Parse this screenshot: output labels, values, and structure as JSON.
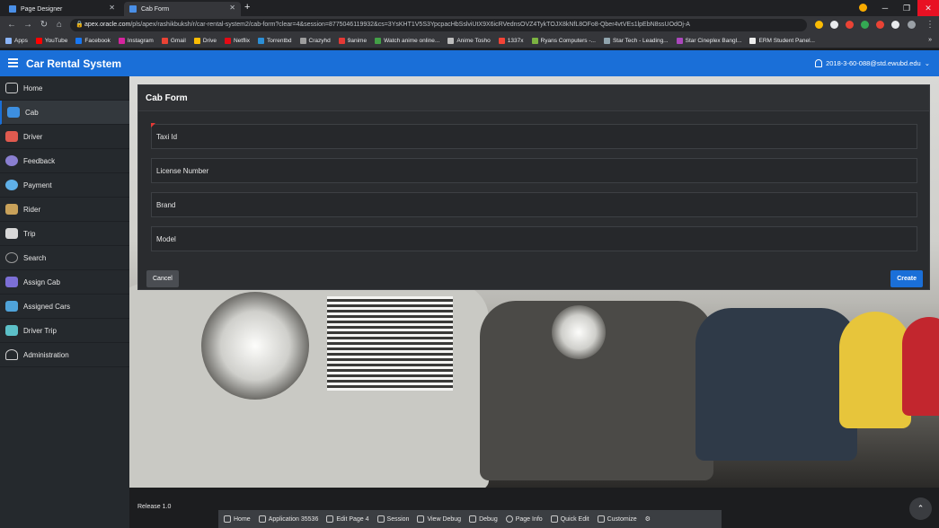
{
  "browser": {
    "tabs": [
      {
        "title": "Page Designer"
      },
      {
        "title": "Cab Form"
      }
    ],
    "new_tab": "+",
    "url_host": "apex.oracle.com",
    "url_path": "/pls/apex/rashikbuksh/r/car-rental-system2/cab-form?clear=4&session=8775046119932&cs=3YsKHT1V5S3YpcpacHbSslviUtX9X6icRVednsOVZ4TykTOJX8kNfL8OFo8-Qber4vtVEs1lpEbN8ssUOdOj-A",
    "bookmarks": [
      "Apps",
      "YouTube",
      "Facebook",
      "Instagram",
      "Gmail",
      "Drive",
      "Netflix",
      "Torrentbd",
      "Crazyhd",
      "9anime",
      "Watch anime online...",
      "Anime Tosho",
      "1337x",
      "Ryans Computers -...",
      "Star Tech - Leading...",
      "Star Cineplex Bangl...",
      "ERM Student Panel..."
    ],
    "bookmarks_more": "»",
    "colors": {
      "frame": "#202124",
      "toolbar": "#35363a"
    }
  },
  "header": {
    "title": "Car Rental System",
    "user": "2018-3-60-088@std.ewubd.edu",
    "brand_color": "#1a6fd8"
  },
  "sidebar": {
    "items": [
      {
        "label": "Home",
        "icon": "home-icon",
        "color": "#cfcfcf"
      },
      {
        "label": "Cab",
        "icon": "cab-icon",
        "color": "#3d8fe0"
      },
      {
        "label": "Driver",
        "icon": "driver-icon",
        "color": "#e05a4f"
      },
      {
        "label": "Feedback",
        "icon": "feedback-icon",
        "color": "#8a7fd1"
      },
      {
        "label": "Payment",
        "icon": "payment-icon",
        "color": "#5fb0e8"
      },
      {
        "label": "Rider",
        "icon": "rider-icon",
        "color": "#c9a25a"
      },
      {
        "label": "Trip",
        "icon": "trip-icon",
        "color": "#d8d8d8"
      },
      {
        "label": "Search",
        "icon": "search-icon",
        "color": "#9a9a9a"
      },
      {
        "label": "Assign Cab",
        "icon": "assign-cab-icon",
        "color": "#7c6fd6"
      },
      {
        "label": "Assigned Cars",
        "icon": "assigned-cars-icon",
        "color": "#4fa3d9"
      },
      {
        "label": "Driver Trip",
        "icon": "driver-trip-icon",
        "color": "#5cc0c8"
      },
      {
        "label": "Administration",
        "icon": "admin-icon",
        "color": "#cfcfcf"
      }
    ],
    "active_index": 1
  },
  "form": {
    "title": "Cab Form",
    "fields": [
      {
        "label": "Taxi Id",
        "required": true
      },
      {
        "label": "License Number",
        "required": false
      },
      {
        "label": "Brand",
        "required": false
      },
      {
        "label": "Model",
        "required": false
      }
    ],
    "cancel_label": "Cancel",
    "create_label": "Create"
  },
  "footer": {
    "release": "Release 1.0",
    "scroll_top_icon": "chevron-up-icon"
  },
  "dev_toolbar": {
    "items": [
      "Home",
      "Application 35536",
      "Edit Page 4",
      "Session",
      "View Debug",
      "Debug",
      "Page Info",
      "Quick Edit",
      "Customize"
    ],
    "settings_icon": "gear-icon"
  }
}
